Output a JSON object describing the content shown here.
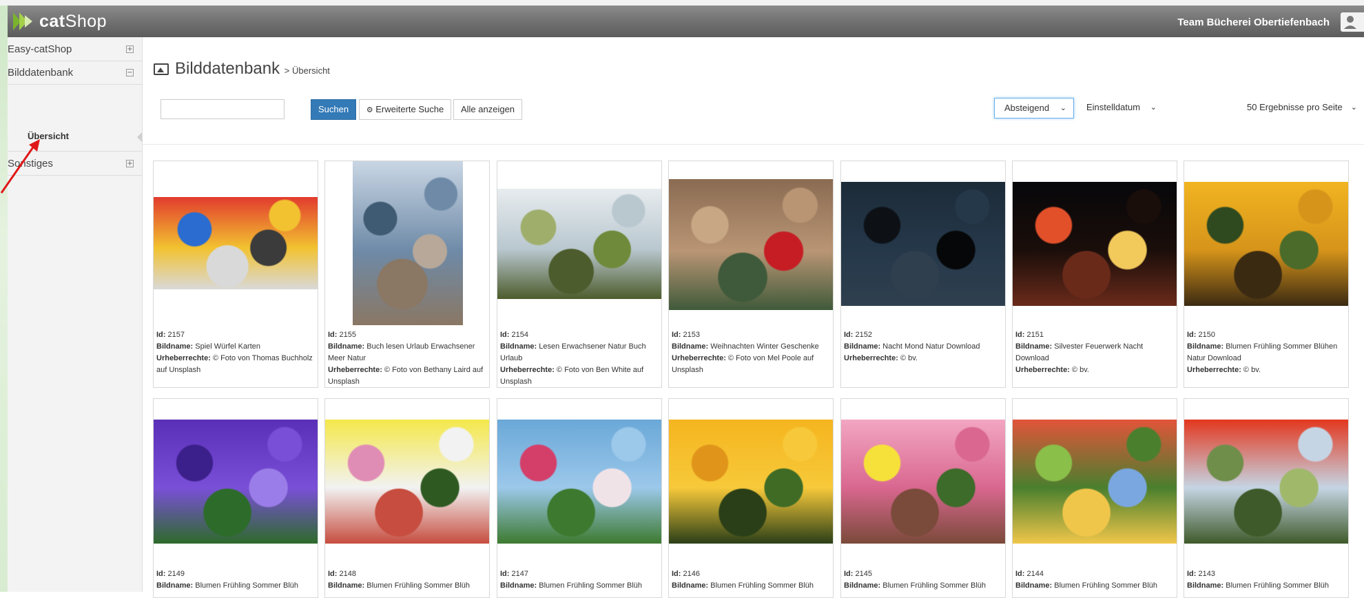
{
  "header": {
    "brand_bold": "cat",
    "brand_rest": "Shop",
    "team": "Team Bücherei Obertiefenbach"
  },
  "sidebar": {
    "items": [
      {
        "label": "Easy-catShop",
        "toggle": "⊞"
      },
      {
        "label": "Bilddatenbank",
        "toggle": "⊟"
      },
      {
        "label": "Sonstiges",
        "toggle": "⊞"
      }
    ],
    "sub": {
      "label": "Übersicht"
    }
  },
  "page": {
    "title": "Bilddatenbank",
    "breadcrumb": "> Übersicht"
  },
  "search": {
    "placeholder": "",
    "search_label": "Suchen",
    "advanced_label": "Erweiterte Suche",
    "show_all_label": "Alle anzeigen"
  },
  "sort": {
    "order": "Absteigend",
    "field": "Einstelldatum",
    "per_page": "50 Ergebnisse pro Seite"
  },
  "labels": {
    "id": "Id:",
    "name": "Bildname:",
    "rights": "Urheberrechte:"
  },
  "images": [
    {
      "id": "2157",
      "name": "Spiel Würfel Karten",
      "rights": "© Foto von Thomas Buchholz auf Unsplash",
      "colors": [
        "#e23b2e",
        "#f2c230",
        "#2a6ccf",
        "#3b3b3b",
        "#d9d9d9"
      ]
    },
    {
      "id": "2155",
      "name": "Buch lesen Urlaub Erwachsener Meer Natur",
      "rights": "© Foto von Bethany Laird auf Unsplash",
      "colors": [
        "#c9d6e4",
        "#6e8aa7",
        "#3f5a73",
        "#b7a89a",
        "#8a7764"
      ]
    },
    {
      "id": "2154",
      "name": "Lesen Erwachsener Natur Buch Urlaub",
      "rights": "© Foto von Ben White auf Unsplash",
      "colors": [
        "#e7ecef",
        "#b9c7cf",
        "#9fae6b",
        "#6f8a3a",
        "#4d5c2c"
      ]
    },
    {
      "id": "2153",
      "name": "Weihnachten Winter Geschenke",
      "rights": "© Foto von Mel Poole auf Unsplash",
      "colors": [
        "#8a6b52",
        "#b99574",
        "#c8a785",
        "#c61d24",
        "#3f5a3a"
      ]
    },
    {
      "id": "2152",
      "name": "Nacht Mond Natur Download",
      "rights": "© bv.",
      "colors": [
        "#1c2b38",
        "#25384a",
        "#0d1116",
        "#060708",
        "#2f3f4e"
      ]
    },
    {
      "id": "2151",
      "name": "Silvester Feuerwerk Nacht Download",
      "rights": "© bv.",
      "colors": [
        "#07070a",
        "#1a0e0a",
        "#e2502a",
        "#f2c95b",
        "#6a2a1a"
      ]
    },
    {
      "id": "2150",
      "name": "Blumen Frühling Sommer Blühen Natur Download",
      "rights": "© bv.",
      "colors": [
        "#f1b421",
        "#d6941a",
        "#2f4a1f",
        "#4a6b2a",
        "#3b2a12"
      ]
    },
    {
      "id": "2149",
      "name": "Blumen Frühling Sommer Blüh",
      "rights": "",
      "colors": [
        "#5a2fb8",
        "#7a4fd8",
        "#3b1f8a",
        "#9a7de8",
        "#2d6b2a"
      ]
    },
    {
      "id": "2148",
      "name": "Blumen Frühling Sommer Blüh",
      "rights": "",
      "colors": [
        "#f4e84a",
        "#f2f2f2",
        "#e08db5",
        "#2e5a22",
        "#c64d3f"
      ]
    },
    {
      "id": "2147",
      "name": "Blumen Frühling Sommer Blüh",
      "rights": "",
      "colors": [
        "#6aa8d8",
        "#9cc8ea",
        "#d43f6a",
        "#f0e3e8",
        "#3d7a2f"
      ]
    },
    {
      "id": "2146",
      "name": "Blumen Frühling Sommer Blüh",
      "rights": "",
      "colors": [
        "#f5b51f",
        "#f7c93a",
        "#e0951a",
        "#3f6b25",
        "#2a3f17"
      ]
    },
    {
      "id": "2145",
      "name": "Blumen Frühling Sommer Blüh",
      "rights": "",
      "colors": [
        "#f2a6c2",
        "#d9678f",
        "#f6e13a",
        "#3d6b2a",
        "#7a4a3a"
      ]
    },
    {
      "id": "2144",
      "name": "Blumen Frühling Sommer Blüh",
      "rights": "",
      "colors": [
        "#e2543a",
        "#4a7f2e",
        "#8abf4a",
        "#7aa7e0",
        "#f0c64a"
      ]
    },
    {
      "id": "2143",
      "name": "Blumen Frühling Sommer Blüh",
      "rights": "",
      "colors": [
        "#e3371e",
        "#c5d5e4",
        "#6f8e4a",
        "#9fb86a",
        "#3f5a2a"
      ]
    }
  ]
}
